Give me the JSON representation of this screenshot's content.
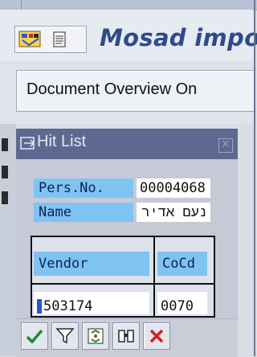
{
  "app": {
    "title": "Mosad impo"
  },
  "toolbar": {
    "document_overview_label": "Document Overview On"
  },
  "hitlist": {
    "title": "Hit List",
    "fields": [
      {
        "label": "Pers.No.",
        "value": "00004068"
      },
      {
        "label": "Name",
        "value": "נעם אדיר"
      }
    ],
    "columns": [
      "Vendor",
      "CoCd"
    ],
    "rows": [
      {
        "vendor": "503174",
        "cocd": "0070"
      }
    ],
    "buttons": [
      "check-icon",
      "filter-icon",
      "sort-icon",
      "find-icon",
      "cancel-icon"
    ]
  },
  "colors": {
    "accent_blue": "#2f4a8c",
    "field_label_bg": "#7fc3f2",
    "window_title_bg": "#5d6991"
  }
}
